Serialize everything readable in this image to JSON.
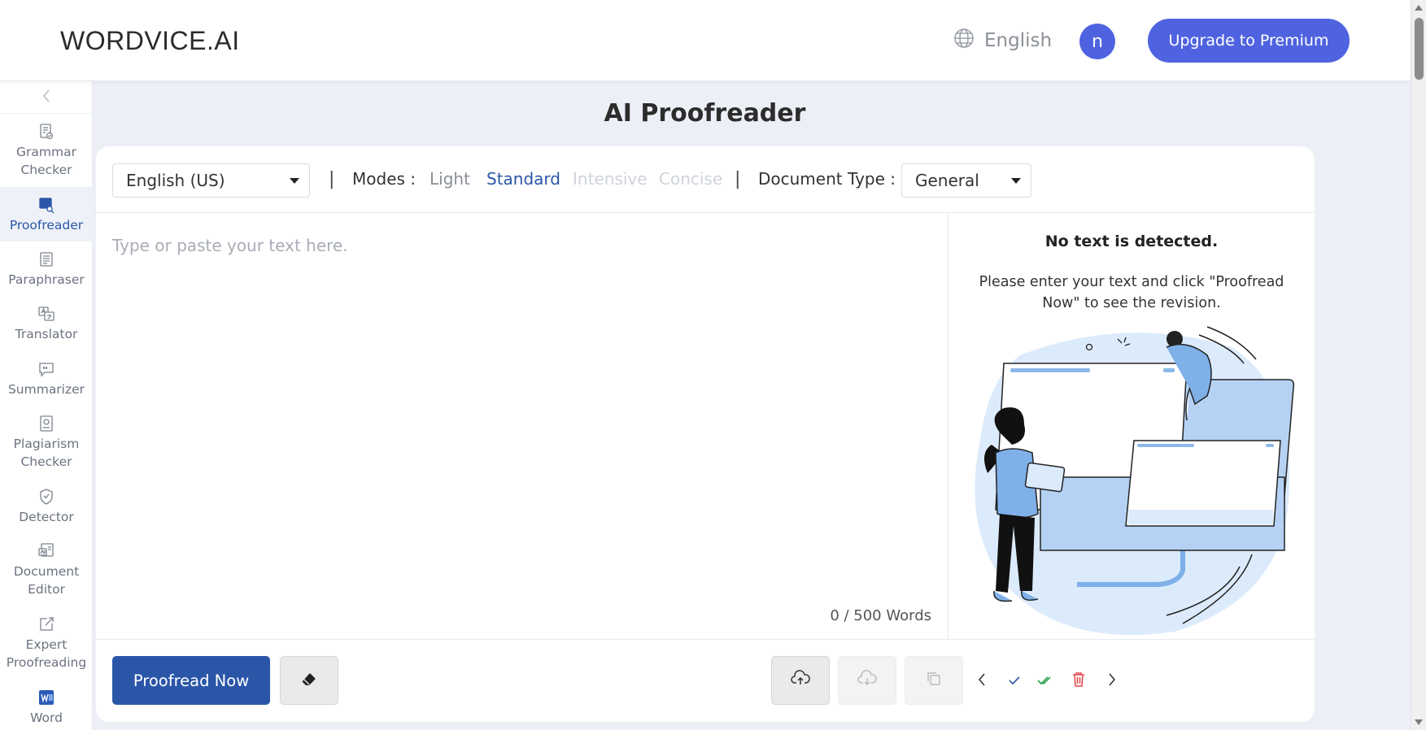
{
  "header": {
    "logo": "WORDVICE.AI",
    "language": "English",
    "avatar_initial": "n",
    "upgrade_label": "Upgrade to Premium"
  },
  "sidebar": {
    "items": [
      {
        "label_lines": [
          "Grammar",
          "Checker"
        ],
        "icon": "grammar-check-icon"
      },
      {
        "label_lines": [
          "Proofreader"
        ],
        "icon": "proofreader-icon",
        "active": true
      },
      {
        "label_lines": [
          "Paraphraser"
        ],
        "icon": "paraphraser-icon"
      },
      {
        "label_lines": [
          "Translator"
        ],
        "icon": "translator-icon"
      },
      {
        "label_lines": [
          "Summarizer"
        ],
        "icon": "summarizer-icon"
      },
      {
        "label_lines": [
          "Plagiarism",
          "Checker"
        ],
        "icon": "plagiarism-icon"
      },
      {
        "label_lines": [
          "Detector"
        ],
        "icon": "detector-icon"
      },
      {
        "label_lines": [
          "Document",
          "Editor"
        ],
        "icon": "document-editor-icon"
      },
      {
        "label_lines": [
          "Expert",
          "Proofreading"
        ],
        "icon": "external-link-icon"
      },
      {
        "label_lines": [
          "Word"
        ],
        "icon": "word-icon"
      }
    ]
  },
  "main": {
    "title": "AI Proofreader",
    "toolbar": {
      "language_select": "English (US)",
      "separator": "|",
      "modes_label": "Modes :",
      "modes": [
        {
          "label": "Light",
          "state": "available"
        },
        {
          "label": "Standard",
          "state": "selected"
        },
        {
          "label": "Intensive",
          "state": "disabled"
        },
        {
          "label": "Concise",
          "state": "disabled"
        }
      ],
      "doc_type_label": "Document Type :",
      "doc_type_select": "General"
    },
    "editor": {
      "placeholder": "Type or paste your text here.",
      "word_count": "0 / 500 Words"
    },
    "result": {
      "title": "No text is detected.",
      "description": "Please enter your text and click \"Proofread Now\" to see the revision."
    },
    "bottom": {
      "proofread_label": "Proofread Now"
    }
  },
  "colors": {
    "brand_blue": "#4f63e0",
    "primary_dark_blue": "#2b56a8",
    "mode_available": "#8a8f98",
    "mode_disabled": "#cfd3da",
    "accept_green": "#2e9f4a",
    "delete_red": "#e0464a"
  }
}
